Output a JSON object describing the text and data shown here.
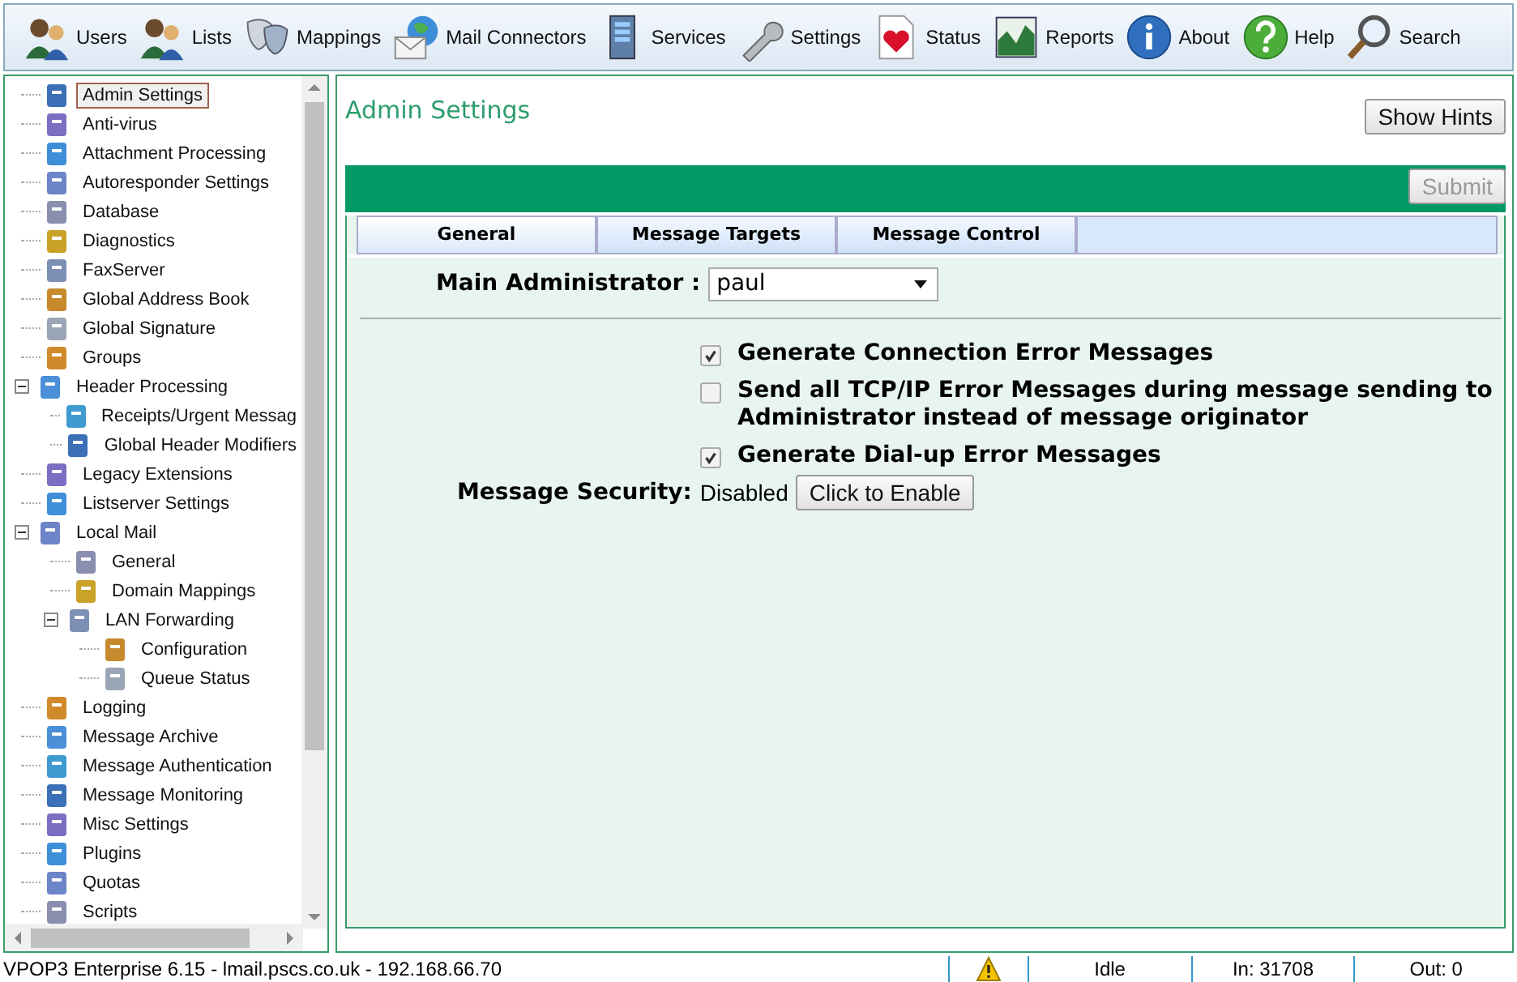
{
  "toolbar": [
    {
      "label": "Users"
    },
    {
      "label": "Lists"
    },
    {
      "label": "Mappings"
    },
    {
      "label": "Mail Connectors"
    },
    {
      "label": "Services"
    },
    {
      "label": "Settings"
    },
    {
      "label": "Status"
    },
    {
      "label": "Reports"
    },
    {
      "label": "About"
    },
    {
      "label": "Help"
    },
    {
      "label": "Search"
    }
  ],
  "tree": [
    {
      "label": "Admin Settings",
      "selected": true
    },
    {
      "label": "Anti-virus",
      "selected": false
    },
    {
      "label": "Attachment Processing",
      "selected": false
    },
    {
      "label": "Autoresponder Settings",
      "selected": false
    },
    {
      "label": "Database",
      "selected": false
    },
    {
      "label": "Diagnostics",
      "selected": false
    },
    {
      "label": "FaxServer",
      "selected": false
    },
    {
      "label": "Global Address Book",
      "selected": false
    },
    {
      "label": "Global Signature",
      "selected": false
    },
    {
      "label": "Groups",
      "selected": false
    },
    {
      "label": "Header Processing",
      "selected": false,
      "expanded": true,
      "children": [
        {
          "label": "Receipts/Urgent Messag",
          "selected": false
        },
        {
          "label": "Global Header Modifiers",
          "selected": false
        }
      ]
    },
    {
      "label": "Legacy Extensions",
      "selected": false
    },
    {
      "label": "Listserver Settings",
      "selected": false
    },
    {
      "label": "Local Mail",
      "selected": false,
      "expanded": true,
      "children": [
        {
          "label": "General",
          "selected": false
        },
        {
          "label": "Domain Mappings",
          "selected": false
        },
        {
          "label": "LAN Forwarding",
          "selected": false,
          "expanded": true,
          "children": [
            {
              "label": "Configuration",
              "selected": false
            },
            {
              "label": "Queue Status",
              "selected": false
            }
          ]
        }
      ]
    },
    {
      "label": "Logging",
      "selected": false
    },
    {
      "label": "Message Archive",
      "selected": false
    },
    {
      "label": "Message Authentication",
      "selected": false
    },
    {
      "label": "Message Monitoring",
      "selected": false
    },
    {
      "label": "Misc Settings",
      "selected": false
    },
    {
      "label": "Plugins",
      "selected": false
    },
    {
      "label": "Quotas",
      "selected": false
    },
    {
      "label": "Scripts",
      "selected": false
    }
  ],
  "page": {
    "title": "Admin Settings",
    "hints_button": "Show Hints",
    "submit_button": {
      "label": "Submit",
      "disabled": true
    }
  },
  "tabs": [
    {
      "label": "General",
      "selected": true
    },
    {
      "label": "Message Targets",
      "selected": false
    },
    {
      "label": "Message Control",
      "selected": false
    }
  ],
  "main_administrator": {
    "label": "Main Administrator :",
    "value": "paul"
  },
  "options": [
    {
      "label": "Generate Connection Error Messages",
      "checked": true
    },
    {
      "label": "Send all TCP/IP Error Messages during message sending to Administrator instead of message originator",
      "checked": false
    },
    {
      "label": "Generate Dial-up Error Messages",
      "checked": true
    }
  ],
  "message_security": {
    "label": "Message Security:",
    "value": "Disabled",
    "button": "Click to Enable"
  },
  "status_bar": {
    "text": "VPOP3 Enterprise 6.15 - lmail.pscs.co.uk - 192.168.66.70",
    "state": "Idle",
    "in": "In: 31708",
    "out": "Out: 0"
  }
}
